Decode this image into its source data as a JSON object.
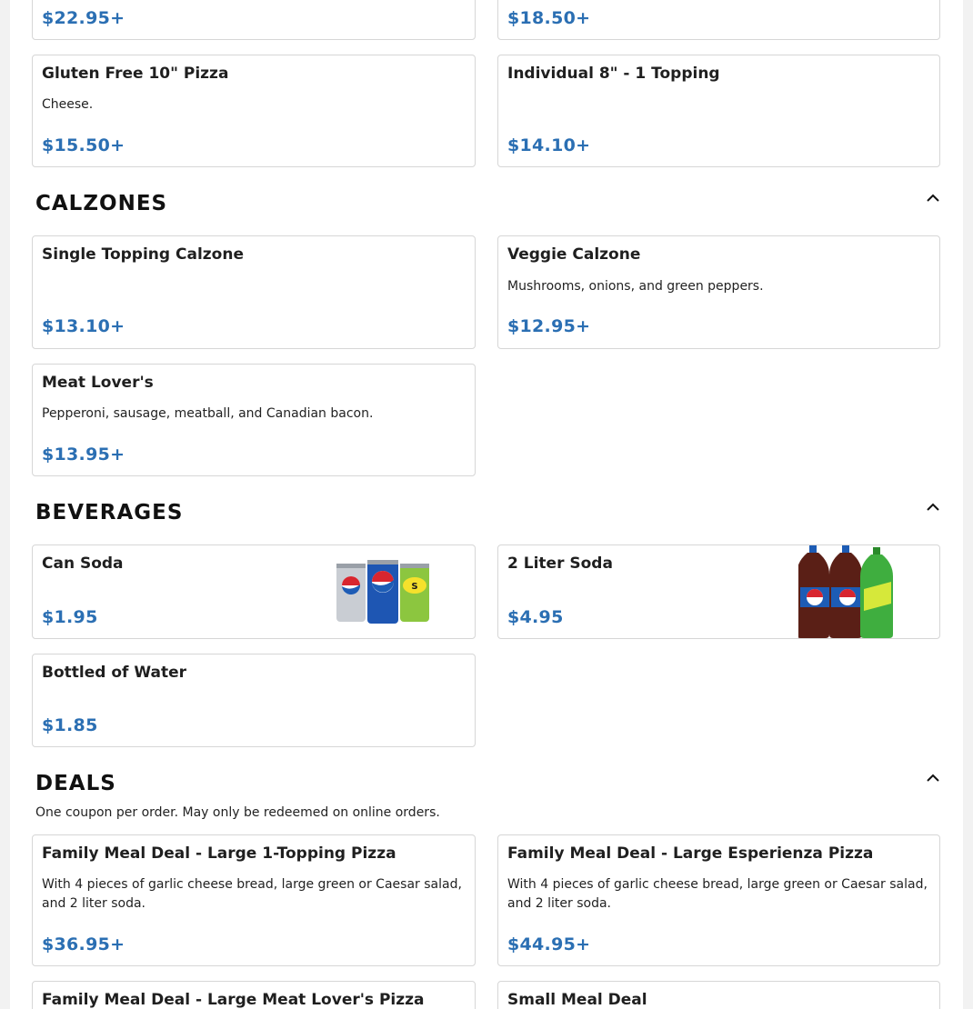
{
  "sections": {
    "pizza_partial": {
      "items": [
        {
          "price": "$22.95+"
        },
        {
          "price": "$18.50+"
        },
        {
          "name": "Gluten Free 10\" Pizza",
          "desc": "Cheese.",
          "price": "$15.50+"
        },
        {
          "name": "Individual 8\" - 1 Topping",
          "desc": "",
          "price": "$14.10+"
        }
      ]
    },
    "calzones": {
      "title": "CALZONES",
      "items": [
        {
          "name": "Single Topping Calzone",
          "desc": "",
          "price": "$13.10+"
        },
        {
          "name": "Veggie Calzone",
          "desc": "Mushrooms, onions, and green peppers.",
          "price": "$12.95+"
        },
        {
          "name": "Meat Lover's",
          "desc": "Pepperoni, sausage, meatball, and Canadian bacon.",
          "price": "$13.95+"
        }
      ]
    },
    "beverages": {
      "title": "BEVERAGES",
      "items": [
        {
          "name": "Can Soda",
          "price": "$1.95",
          "image": "pepsi-cans-image"
        },
        {
          "name": "2 Liter Soda",
          "price": "$4.95",
          "image": "soda-bottles-image"
        },
        {
          "name": "Bottled of Water",
          "price": "$1.85"
        }
      ]
    },
    "deals": {
      "title": "DEALS",
      "note": "One coupon per order. May only be redeemed on online orders.",
      "items": [
        {
          "name": "Family Meal Deal - Large 1-Topping Pizza",
          "desc": "With 4 pieces of garlic cheese bread, large green or Caesar salad, and 2 liter soda.",
          "price": "$36.95+"
        },
        {
          "name": "Family Meal Deal - Large Esperienza Pizza",
          "desc": "With 4 pieces of garlic cheese bread, large green or Caesar salad, and 2 liter soda.",
          "price": "$44.95+"
        },
        {
          "name": "Family Meal Deal - Large Meat Lover's Pizza"
        },
        {
          "name": "Small Meal Deal"
        }
      ]
    }
  },
  "colors": {
    "price": "#2b6fb3",
    "border": "#d6d6d6"
  },
  "icons": {
    "collapse": "chevron-up-icon"
  }
}
